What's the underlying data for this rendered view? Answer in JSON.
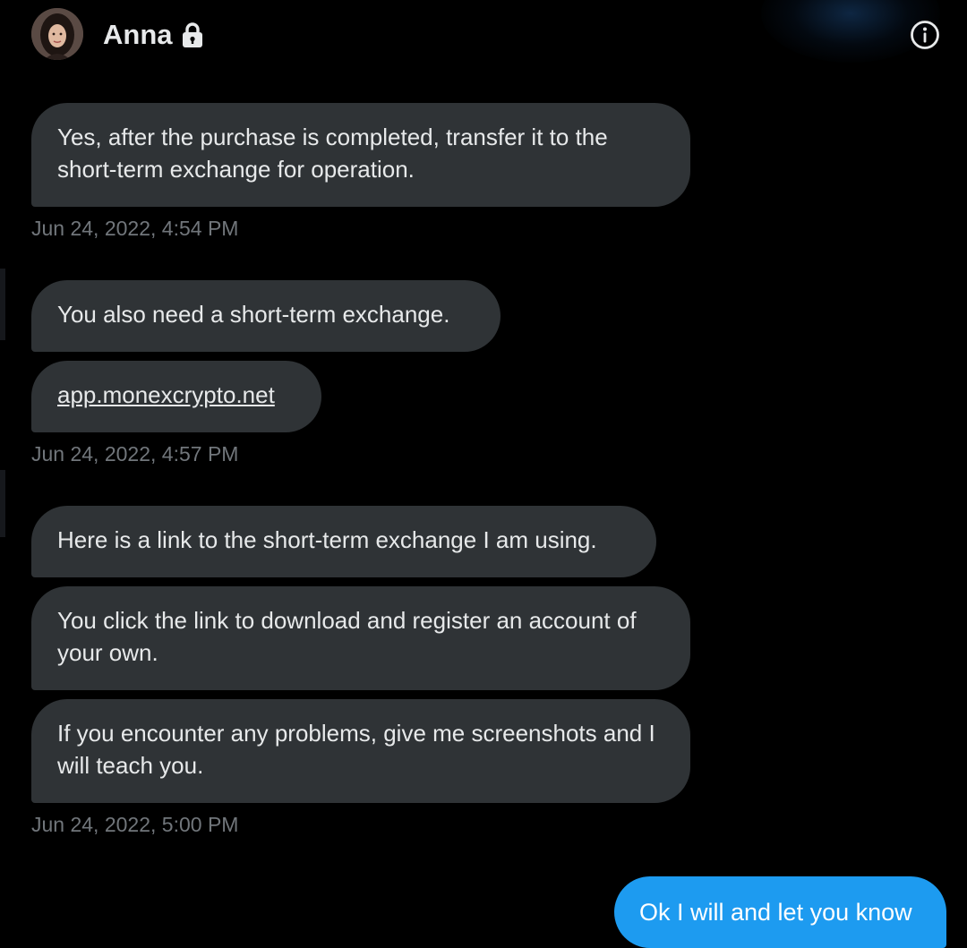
{
  "header": {
    "name": "Anna",
    "avatar_icon": "avatar",
    "lock_icon": "lock-icon",
    "info_icon": "info-icon"
  },
  "messages": {
    "m1": "Yes, after the purchase is completed, transfer it to the short-term exchange for operation.",
    "t1": "Jun 24, 2022, 4:54 PM",
    "m2": "You also need a short-term exchange.",
    "m3": "app.monexcrypto.net",
    "t2": "Jun 24, 2022, 4:57 PM",
    "m4": "Here is a link to the short-term exchange I am using.",
    "m5": "You click the link to download and register an account of your own.",
    "m6": "If you encounter any problems, give me screenshots and I will teach you.",
    "t3": "Jun 24, 2022, 5:00 PM",
    "m7": "Ok I will and let you know"
  },
  "colors": {
    "background": "#000000",
    "incoming_bubble": "#2f3336",
    "outgoing_bubble": "#1d9bf0",
    "timestamp": "#71767b",
    "text": "#e7e9ea"
  }
}
